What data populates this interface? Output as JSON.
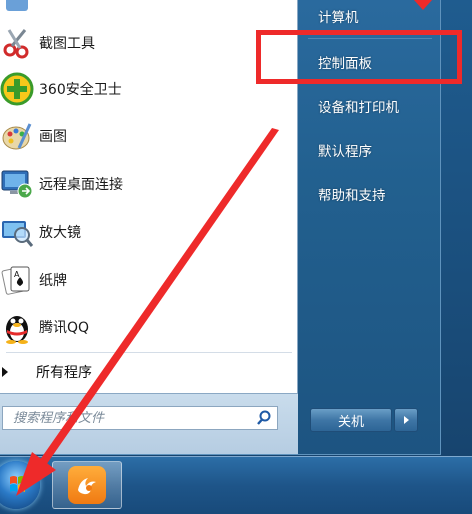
{
  "start_menu": {
    "programs": [
      {
        "label": "截图工具",
        "icon": "snipping-tool-icon"
      },
      {
        "label": "360安全卫士",
        "icon": "360-security-icon"
      },
      {
        "label": "画图",
        "icon": "paint-icon"
      },
      {
        "label": "远程桌面连接",
        "icon": "remote-desktop-icon"
      },
      {
        "label": "放大镜",
        "icon": "magnifier-icon"
      },
      {
        "label": "纸牌",
        "icon": "solitaire-icon"
      },
      {
        "label": "腾讯QQ",
        "icon": "qq-penguin-icon"
      }
    ],
    "all_programs_label": "所有程序",
    "search": {
      "placeholder": "搜索程序和文件"
    },
    "right_items": [
      {
        "label": "计算机"
      },
      {
        "label": "控制面板"
      },
      {
        "label": "设备和打印机"
      },
      {
        "label": "默认程序"
      },
      {
        "label": "帮助和支持"
      }
    ],
    "shutdown_label": "关机"
  },
  "colors": {
    "annotation_red": "#ee2a2a",
    "menu_blue": "#22608f",
    "taskbar_blue": "#1e5589"
  }
}
